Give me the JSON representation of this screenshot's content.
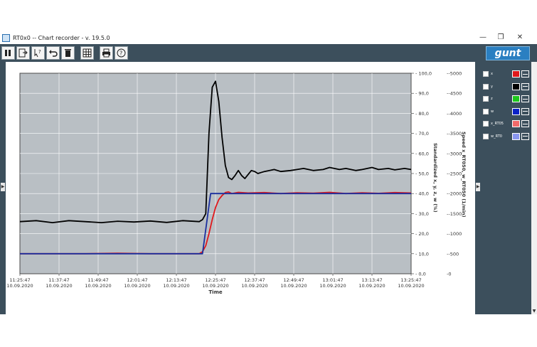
{
  "window": {
    "title": "RT0x0  --  Chart recorder - v. 19.5.0",
    "minimize": "—",
    "maximize": "❐",
    "close": "✕"
  },
  "toolbar": {
    "buttons": [
      "pause-icon",
      "export-icon",
      "help-cursor-icon",
      "undo-icon",
      "trash-icon",
      "grid-icon",
      "print-icon",
      "help-icon"
    ],
    "logo": "gunt"
  },
  "legend": [
    {
      "name": "x",
      "color": "#e0191c"
    },
    {
      "name": "y",
      "color": "#000000"
    },
    {
      "name": "z",
      "color": "#1cc81c"
    },
    {
      "name": "w",
      "color": "#0a22c8"
    },
    {
      "name": "x_RT05",
      "color": "#f06a6a"
    },
    {
      "name": "w_RT0",
      "color": "#8a97f0"
    }
  ],
  "chart_data": {
    "type": "line",
    "xlabel": "Time",
    "ylabel_right": "Standardized  x, y, z, w    (%)",
    "ylabel_right2": "Speed  x_RT050, w_RT050    (1/min)",
    "x_ticks": [
      [
        "11:25:47",
        "10.09.2020"
      ],
      [
        "11:37:47",
        "10.09.2020"
      ],
      [
        "11:49:47",
        "10.09.2020"
      ],
      [
        "12:01:47",
        "10.09.2020"
      ],
      [
        "12:13:47",
        "10.09.2020"
      ],
      [
        "12:25:47",
        "10.09.2020"
      ],
      [
        "12:37:47",
        "10.09.2020"
      ],
      [
        "12:49:47",
        "10.09.2020"
      ],
      [
        "13:01:47",
        "10.09.2020"
      ],
      [
        "13:13:47",
        "10.09.2020"
      ],
      [
        "13:25:47",
        "10.09.2020"
      ]
    ],
    "y_ticks_right": [
      "0,0",
      "10,0",
      "20,0",
      "30,0",
      "40,0",
      "50,0",
      "60,0",
      "70,0",
      "80,0",
      "90,0",
      "100,0"
    ],
    "y_ticks_right2": [
      "0",
      "-500",
      "-1000",
      "-1500",
      "-2000",
      "-2500",
      "-3000",
      "-3500",
      "-4000",
      "-4500",
      "-5000"
    ],
    "ylim": [
      0,
      100
    ],
    "x_range_minutes": [
      0,
      120
    ],
    "series": [
      {
        "name": "y",
        "color": "#000000",
        "points": [
          [
            0,
            26
          ],
          [
            5,
            26.5
          ],
          [
            10,
            25.5
          ],
          [
            15,
            26.5
          ],
          [
            20,
            26
          ],
          [
            25,
            25.5
          ],
          [
            30,
            26.2
          ],
          [
            35,
            25.8
          ],
          [
            40,
            26.3
          ],
          [
            45,
            25.6
          ],
          [
            50,
            26.5
          ],
          [
            55,
            26
          ],
          [
            56,
            27
          ],
          [
            57,
            30
          ],
          [
            58,
            70
          ],
          [
            59,
            93
          ],
          [
            60,
            96
          ],
          [
            61,
            86
          ],
          [
            62,
            68
          ],
          [
            63,
            54
          ],
          [
            64,
            48
          ],
          [
            65,
            47
          ],
          [
            66,
            49
          ],
          [
            67,
            51.5
          ],
          [
            68,
            49
          ],
          [
            69,
            47.5
          ],
          [
            70,
            49.5
          ],
          [
            71,
            51.5
          ],
          [
            72,
            51
          ],
          [
            73,
            50
          ],
          [
            75,
            51
          ],
          [
            78,
            52
          ],
          [
            80,
            51
          ],
          [
            83,
            51.5
          ],
          [
            85,
            52
          ],
          [
            87,
            52.5
          ],
          [
            90,
            51.5
          ],
          [
            93,
            52
          ],
          [
            95,
            53
          ],
          [
            98,
            52
          ],
          [
            100,
            52.5
          ],
          [
            103,
            51.5
          ],
          [
            105,
            52
          ],
          [
            108,
            53
          ],
          [
            110,
            52
          ],
          [
            113,
            52.5
          ],
          [
            115,
            51.8
          ],
          [
            118,
            52.5
          ],
          [
            120,
            52
          ]
        ]
      },
      {
        "name": "x",
        "color": "#e0191c",
        "points": [
          [
            0,
            10
          ],
          [
            20,
            10
          ],
          [
            30,
            10.2
          ],
          [
            40,
            10
          ],
          [
            50,
            10
          ],
          [
            55,
            10
          ],
          [
            56,
            11
          ],
          [
            57,
            14
          ],
          [
            58,
            20
          ],
          [
            59,
            27
          ],
          [
            60,
            33
          ],
          [
            61,
            37
          ],
          [
            62,
            39
          ],
          [
            63,
            40.5
          ],
          [
            64,
            40.8
          ],
          [
            65,
            40
          ],
          [
            67,
            40.6
          ],
          [
            70,
            40.3
          ],
          [
            75,
            40.5
          ],
          [
            80,
            40
          ],
          [
            85,
            40.4
          ],
          [
            90,
            40.2
          ],
          [
            95,
            40.6
          ],
          [
            100,
            40
          ],
          [
            105,
            40.4
          ],
          [
            110,
            40.1
          ],
          [
            115,
            40.5
          ],
          [
            120,
            40.3
          ]
        ]
      },
      {
        "name": "w",
        "color": "#1b2f9e",
        "points": [
          [
            0,
            10
          ],
          [
            55,
            10
          ],
          [
            56,
            10
          ],
          [
            58.5,
            40
          ],
          [
            120,
            40
          ]
        ]
      }
    ]
  }
}
